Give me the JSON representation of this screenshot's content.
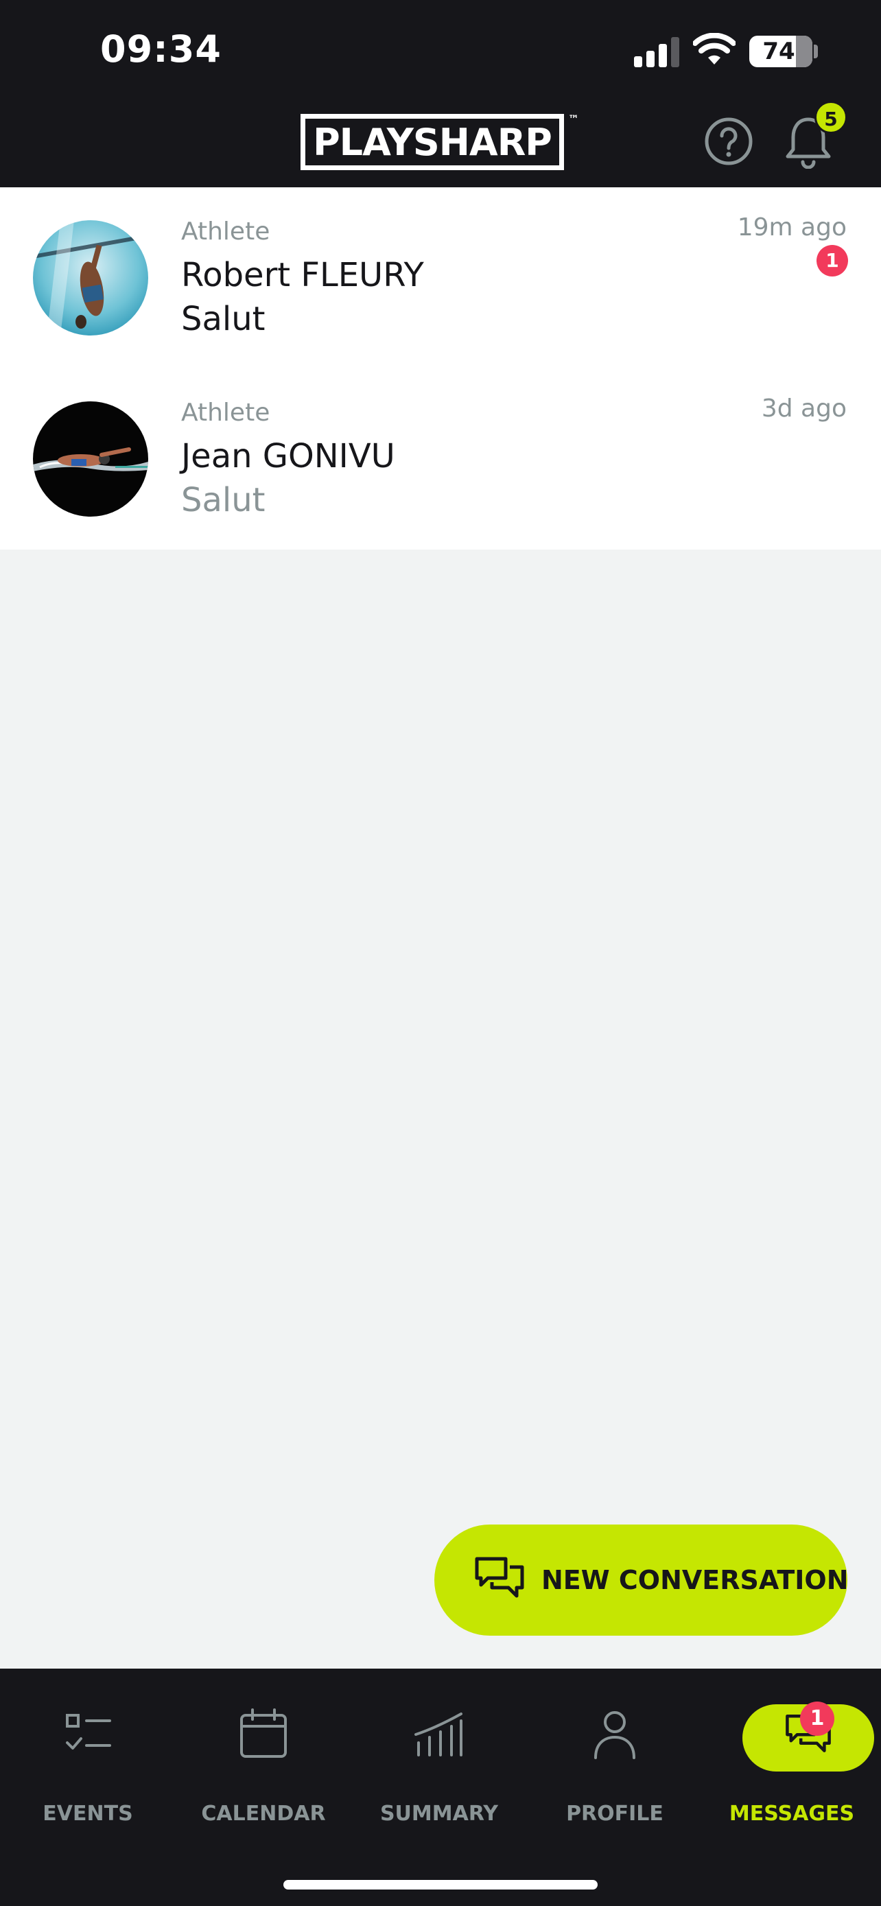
{
  "status_bar": {
    "time": "09:34",
    "battery_percent": "74",
    "battery_level": 0.74
  },
  "header": {
    "logo_text_play": "PLAY",
    "logo_text_sharp": "SHARP",
    "logo_trademark": "™",
    "notification_count": "5"
  },
  "conversations": [
    {
      "role": "Athlete",
      "name": "Robert FLEURY",
      "preview": "Salut",
      "time": "19m ago",
      "unread_count": "1",
      "avatar": "swimmer-underwater-photo"
    },
    {
      "role": "Athlete",
      "name": "Jean GONIVU",
      "preview": "Salut",
      "time": "3d ago",
      "avatar": "swimmer-freestyle-photo"
    }
  ],
  "fab": {
    "label": "NEW CONVERSATION",
    "icon": "chat-bubbles-icon"
  },
  "bottom_nav": {
    "items": [
      {
        "label": "EVENTS",
        "icon": "checklist-icon"
      },
      {
        "label": "CALENDAR",
        "icon": "calendar-icon"
      },
      {
        "label": "SUMMARY",
        "icon": "bar-chart-icon"
      },
      {
        "label": "PROFILE",
        "icon": "person-icon"
      },
      {
        "label": "MESSAGES",
        "icon": "chat-bubbles-icon",
        "active": true,
        "badge": "1"
      }
    ]
  },
  "colors": {
    "accent": "#c5e602",
    "dark": "#16161a",
    "badge_red": "#f23a5b",
    "muted_text": "#8a9496",
    "background": "#f1f3f3"
  }
}
